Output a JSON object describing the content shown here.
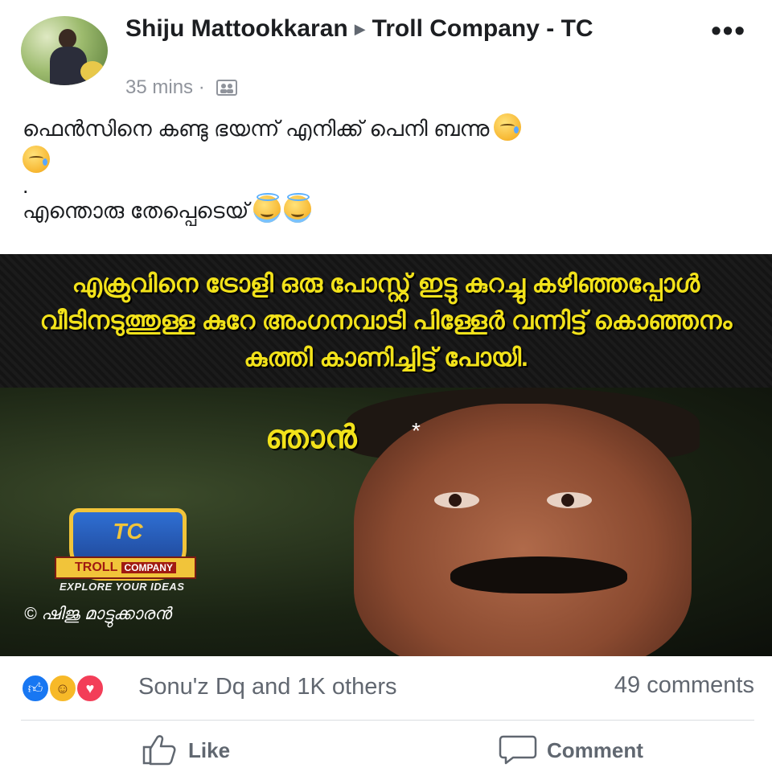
{
  "post": {
    "author": "Shiju Mattookkaran",
    "group": "Troll Company - TC",
    "time": "35 mins",
    "separator": "·",
    "more": "•••",
    "text": {
      "line1": "ഫെൻസിനെ കണ്ടു ഭയന്ന് എനിക്ക് പെനി ബന്നു",
      "line2": "",
      "line3": ".",
      "line4": "എന്തൊരു തേപ്പെടെയ്"
    }
  },
  "meme": {
    "caption": "എക്രുവിനെ ട്രോളി ഒരു പോസ്റ്റ് ഇട്ടു കുറച്ചു കഴിഞ്ഞപ്പോൾ വീടിനടുത്തുള്ള കുറേ അംഗനവാടി പിള്ളേർ വന്നിട്ട് കൊഞ്ഞനം കുത്തി കാണിച്ചിട്ട് പോയി.",
    "face_caption": "ഞാൻ",
    "sparkle": "*",
    "logo": {
      "initials": "TC",
      "word1": "TROLL",
      "word2": "COMPANY",
      "tagline": "EXPLORE YOUR IDEAS"
    },
    "credit": "© ഷിജു മാട്ടുക്കാരൻ"
  },
  "reactions": {
    "icons": [
      "like-icon",
      "haha-icon",
      "love-icon"
    ],
    "reactors_text": "Sonu'z Dq and 1K others",
    "comments_text": "49 comments"
  },
  "actions": {
    "like_label": "Like",
    "comment_label": "Comment"
  },
  "colors": {
    "like_blue": "#1877f2",
    "haha_yellow": "#f7b928",
    "love_red": "#f33e58",
    "caption_yellow": "#f2e21a",
    "secondary_text": "#616770"
  }
}
